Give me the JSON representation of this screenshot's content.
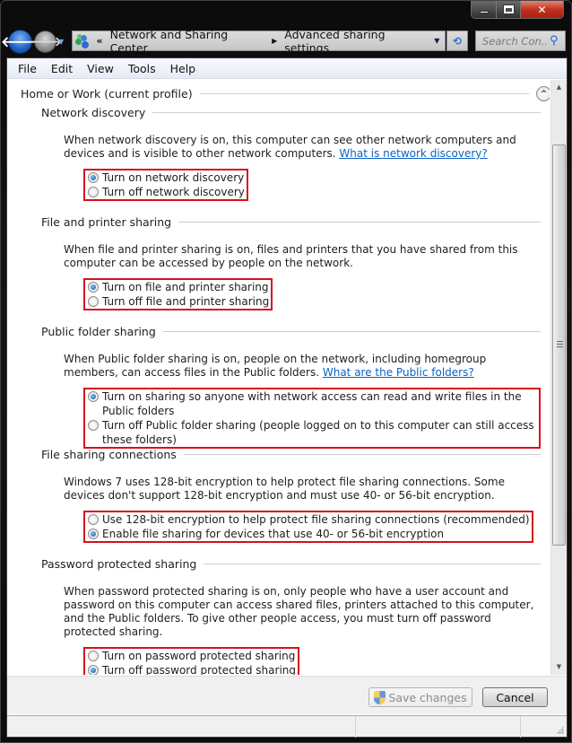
{
  "window": {
    "caption": {
      "minimize": "minimize",
      "maximize": "maximize",
      "close": "✕"
    }
  },
  "nav": {
    "back": "🡐",
    "forward": "🡒",
    "recent": "▼",
    "breadcrumb": [
      "Network and Sharing Center",
      "Advanced sharing settings"
    ],
    "overflow": "«",
    "separator": "▶",
    "dropdown": "▼",
    "refresh": "⟲",
    "search_placeholder": "Search Con...",
    "search_icon": "⚲"
  },
  "menu": [
    "File",
    "Edit",
    "View",
    "Tools",
    "Help"
  ],
  "profile": {
    "title": "Home or Work (current profile)",
    "collapse_glyph": "︿"
  },
  "sections": [
    {
      "title": "Network discovery",
      "desc": "When network discovery is on, this computer can see other network computers and devices and is visible to other network computers.",
      "link": "What is network discovery?",
      "options": [
        {
          "label": "Turn on network discovery",
          "selected": true
        },
        {
          "label": "Turn off network discovery",
          "selected": false
        }
      ]
    },
    {
      "title": "File and printer sharing",
      "desc": "When file and printer sharing is on, files and printers that you have shared from this computer can be accessed by people on the network.",
      "link": "",
      "options": [
        {
          "label": "Turn on file and printer sharing",
          "selected": true
        },
        {
          "label": "Turn off file and printer sharing",
          "selected": false
        }
      ]
    },
    {
      "title": "Public folder sharing",
      "desc": "When Public folder sharing is on, people on the network, including homegroup members, can access files in the Public folders.",
      "link": "What are the Public folders?",
      "options": [
        {
          "label": "Turn on sharing so anyone with network access can read and write files in the Public folders",
          "selected": true
        },
        {
          "label": "Turn off Public folder sharing (people logged on to this computer can still access these folders)",
          "selected": false
        }
      ]
    },
    {
      "title": "File sharing connections",
      "desc": "Windows 7 uses 128-bit encryption to help protect file sharing connections. Some devices don't support 128-bit encryption and must use 40- or 56-bit encryption.",
      "link": "",
      "options": [
        {
          "label": "Use 128-bit encryption to help protect file sharing connections (recommended)",
          "selected": false
        },
        {
          "label": "Enable file sharing for devices that use 40- or 56-bit encryption",
          "selected": true
        }
      ]
    },
    {
      "title": "Password protected sharing",
      "desc": "When password protected sharing is on, only people who have a user account and password on this computer can access shared files, printers attached to this computer, and the Public folders. To give other people access, you must turn off password protected sharing.",
      "link": "",
      "options": [
        {
          "label": "Turn on password protected sharing",
          "selected": false
        },
        {
          "label": "Turn off password protected sharing",
          "selected": true
        }
      ]
    }
  ],
  "scrollbar": {
    "up": "▲",
    "down": "▼",
    "position_fraction": 0.1
  },
  "footer": {
    "save_label": "Save changes",
    "save_enabled": false,
    "cancel_label": "Cancel"
  }
}
